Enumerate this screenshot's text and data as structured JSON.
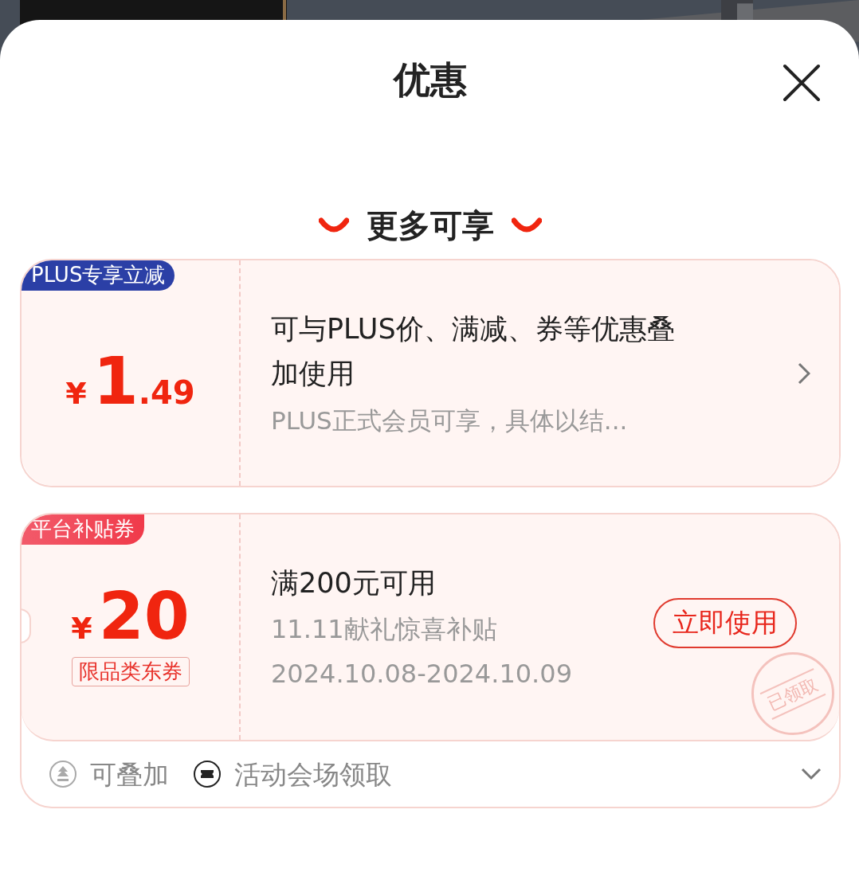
{
  "sheet": {
    "title": "优惠",
    "section_title": "更多可享"
  },
  "offers": [
    {
      "kind": "info",
      "tag": "PLUS专享立减",
      "currency": "¥",
      "amount": "1",
      "decimal": ".49",
      "title": "可与PLUS价、满减、券等优惠叠加使用",
      "subtitle": "PLUS正式会员可享，具体以结..."
    },
    {
      "kind": "coupon",
      "tag": "平台补贴券",
      "currency": "¥",
      "amount": "20",
      "scope": "限品类东券",
      "title": "满200元可用",
      "lines": [
        "11.11献礼惊喜补贴",
        "2024.10.08-2024.10.09"
      ],
      "button": "立即使用",
      "stamp": "已领取",
      "footer": [
        {
          "kind": "stack",
          "text": "可叠加"
        },
        {
          "kind": "venue",
          "text": "活动会场领取"
        }
      ],
      "expanded": false
    }
  ]
}
